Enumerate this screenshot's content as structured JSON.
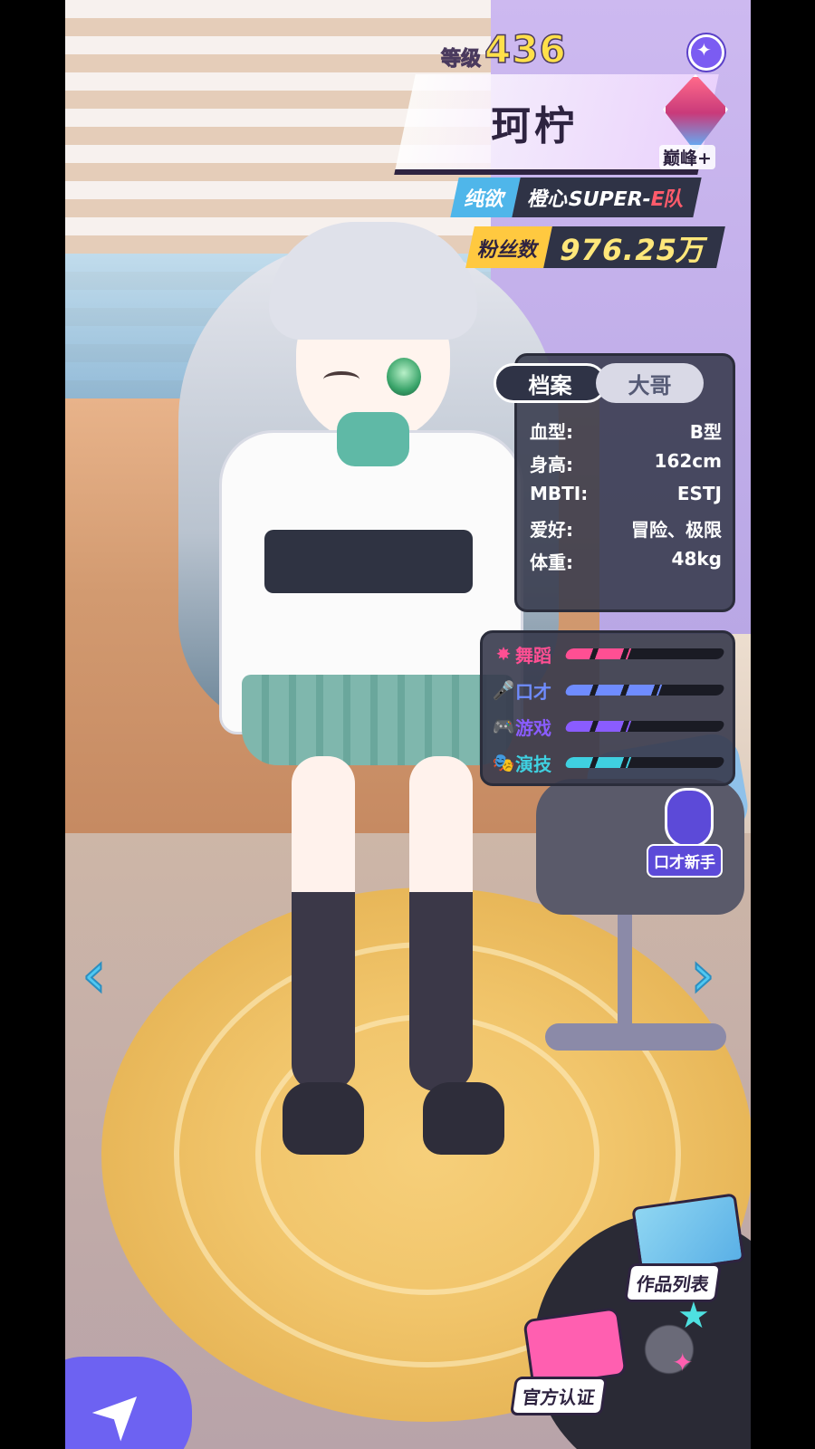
{
  "level": {
    "label": "等级",
    "value": "436"
  },
  "character": {
    "name": "珂柠",
    "rank": "巅峰+"
  },
  "team": {
    "tag": "纯欲",
    "name_main": "橙心SUPER-",
    "name_accent": "E队"
  },
  "fans": {
    "label": "粉丝数",
    "value": "976.25万"
  },
  "profile": {
    "tabs": [
      {
        "label": "档案",
        "active": true
      },
      {
        "label": "大哥",
        "active": false
      }
    ],
    "rows": [
      {
        "label": "血型:",
        "value": "B型"
      },
      {
        "label": "身高:",
        "value": "162cm"
      },
      {
        "label": "MBTI:",
        "value": "ESTJ"
      },
      {
        "label": "爱好:",
        "value": "冒险、极限"
      },
      {
        "label": "体重:",
        "value": "48kg"
      }
    ]
  },
  "skills": [
    {
      "name": "舞蹈",
      "icon": "dancer-icon",
      "glyph": "✸",
      "color": "#ff4f93",
      "level": 0.4
    },
    {
      "name": "口才",
      "icon": "microphone-icon",
      "glyph": "🎤",
      "color": "#6f8cff",
      "level": 0.6
    },
    {
      "name": "游戏",
      "icon": "gamepad-icon",
      "glyph": "🎮",
      "color": "#8a5cff",
      "level": 0.4
    },
    {
      "name": "演技",
      "icon": "mask-icon",
      "glyph": "🎭",
      "color": "#3fd0e0",
      "level": 0.4
    }
  ],
  "mic_badge": {
    "label": "口才新手"
  },
  "works_button": {
    "label": "作品列表"
  },
  "cert_button": {
    "label": "官方认证"
  },
  "nav": {
    "prev": "‹",
    "next": "›"
  },
  "colors": {
    "accent_blue": "#4fb6ea",
    "accent_gold": "#ffc940",
    "panel_dark": "#2f3346"
  }
}
